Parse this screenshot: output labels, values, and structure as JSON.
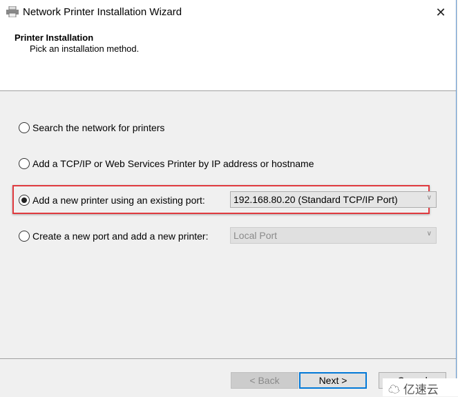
{
  "window": {
    "title": "Network Printer Installation Wizard",
    "icon": "printer-icon",
    "close_glyph": "✕"
  },
  "header": {
    "title": "Printer Installation",
    "subtitle": "Pick an installation method."
  },
  "options": [
    {
      "label": "Search the network for printers",
      "selected": false
    },
    {
      "label": "Add a TCP/IP or Web Services Printer by IP address or hostname",
      "selected": false
    },
    {
      "label": "Add a new printer using an existing port:",
      "selected": true,
      "combo_value": "192.168.80.20 (Standard TCP/IP Port)",
      "combo_enabled": true
    },
    {
      "label": "Create a new port and add a new printer:",
      "selected": false,
      "combo_value": "Local Port",
      "combo_enabled": false
    }
  ],
  "highlight_color": "#e0393e",
  "buttons": {
    "back": "< Back",
    "next": "Next >",
    "cancel": "Cancel"
  },
  "watermark": "亿速云"
}
